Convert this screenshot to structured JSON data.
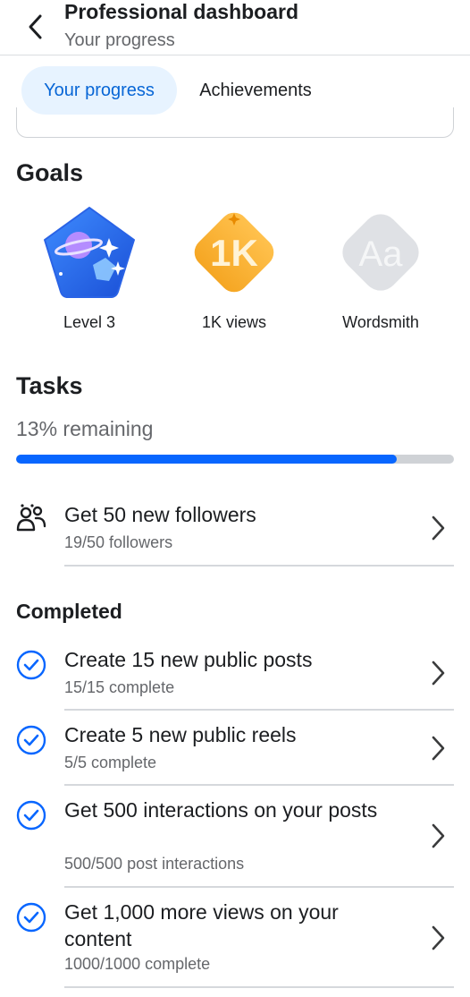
{
  "header": {
    "title": "Professional dashboard",
    "subtitle": "Your progress"
  },
  "tabs": [
    {
      "label": "Your progress",
      "active": true
    },
    {
      "label": "Achievements",
      "active": false
    }
  ],
  "goals": {
    "title": "Goals",
    "items": [
      {
        "label": "Level 3",
        "icon": "planet-badge-icon"
      },
      {
        "label": "1K views",
        "icon": "1k-badge-icon",
        "badge_text": "1K"
      },
      {
        "label": "Wordsmith",
        "icon": "wordsmith-badge-icon",
        "badge_text": "Aa"
      }
    ]
  },
  "tasks": {
    "title": "Tasks",
    "remaining_text": "13% remaining",
    "progress_fraction": 0.87,
    "items": [
      {
        "title": "Get 50 new followers",
        "subtitle": "19/50 followers",
        "icon": "followers-icon"
      }
    ]
  },
  "completed": {
    "title": "Completed",
    "items": [
      {
        "title": "Create 15 new public posts",
        "subtitle": "15/15 complete",
        "icon": "check-circle-icon"
      },
      {
        "title": "Create 5 new public reels",
        "subtitle": "5/5 complete",
        "icon": "check-circle-icon"
      },
      {
        "title": "Get 500 interactions on your posts",
        "subtitle": "500/500 post interactions",
        "icon": "check-circle-icon"
      },
      {
        "title": "Get 1,000 more views on your content",
        "subtitle": "1000/1000 complete",
        "icon": "check-circle-icon"
      }
    ]
  },
  "colors": {
    "accent": "#0866ff",
    "tab_active_bg": "#e7f3ff",
    "track": "#cfd2d6"
  }
}
